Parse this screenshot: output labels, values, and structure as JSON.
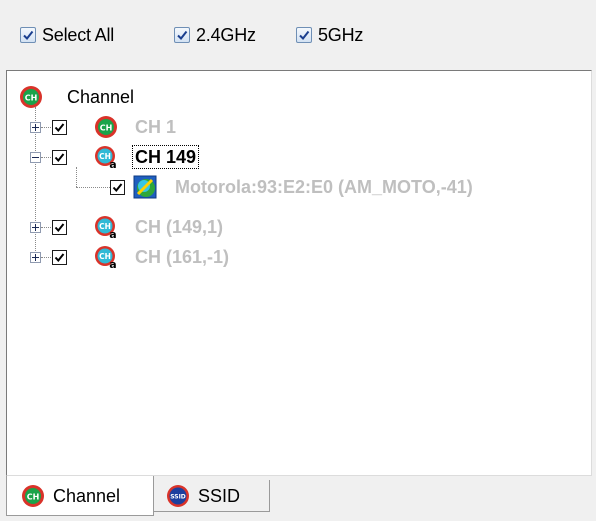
{
  "filters": {
    "select_all": {
      "label": "Select All",
      "checked": true
    },
    "band_24": {
      "label": "2.4GHz",
      "checked": true
    },
    "band_5": {
      "label": "5GHz",
      "checked": true
    }
  },
  "tree": {
    "root_label": "Channel",
    "nodes": [
      {
        "label": "CH 1",
        "checked": true,
        "expanded": false,
        "icon": "channel-icon"
      },
      {
        "label": "CH 149",
        "checked": true,
        "expanded": true,
        "selected": true,
        "icon": "channel-a-icon"
      },
      {
        "label": "Motorola:93:E2:E0 (AM_MOTO,-41)",
        "checked": true,
        "icon": "access-point-icon"
      },
      {
        "label": "CH (149,1)",
        "checked": true,
        "expanded": false,
        "icon": "channel-a-icon"
      },
      {
        "label": "CH (161,-1)",
        "checked": true,
        "expanded": false,
        "icon": "channel-a-icon"
      }
    ]
  },
  "tabs": [
    {
      "label": "Channel",
      "active": true,
      "icon": "channel-icon"
    },
    {
      "label": "SSID",
      "active": false,
      "icon": "ssid-icon"
    }
  ],
  "icon_text": {
    "channel": "CH",
    "ssid": "SSID",
    "band_a": "a"
  },
  "colors": {
    "channel_icon_ring": "#d9332a",
    "channel_icon_core": "#1aa34a",
    "channel_a_core": "#2fb9d6",
    "selected_text": "#000000",
    "disabled_text": "#bfbfbf"
  }
}
